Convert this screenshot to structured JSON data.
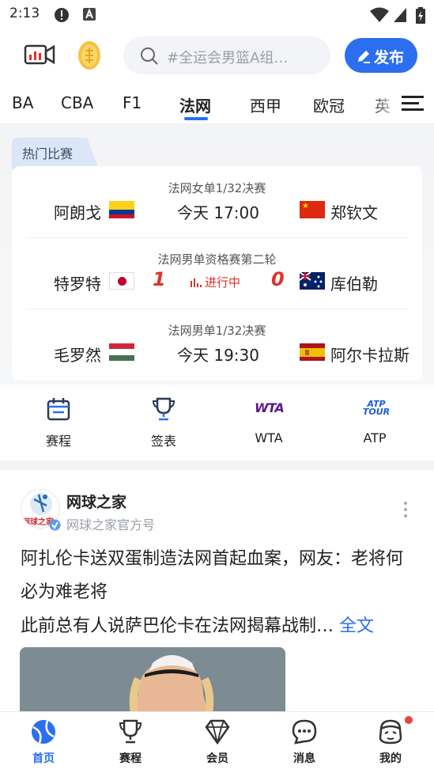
{
  "status_bar": {
    "time": "2:13",
    "icons": [
      "alert-circle-icon",
      "app-a-icon",
      "wifi-icon",
      "signal-icon",
      "battery-charging-icon"
    ]
  },
  "top_bar": {
    "left_icons": [
      "video-chart-icon",
      "gold-coin-icon"
    ],
    "search_placeholder": "#全运会男篮A组…",
    "publish_label": "发布"
  },
  "tabs": {
    "items": [
      "BA",
      "CBA",
      "F1",
      "法网",
      "西甲",
      "欧冠",
      "英"
    ],
    "active": "法网",
    "menu_icon": "menu-icon"
  },
  "hot_matches": {
    "tag": "热门比赛",
    "matches": [
      {
        "stage": "法网女单1/32决赛",
        "left_player": "阿朗戈",
        "left_flag": "Colombia",
        "center": "今天 17:00",
        "right_player": "郑钦文",
        "right_flag": "China"
      },
      {
        "stage": "法网男单资格赛第二轮",
        "left_player": "特罗特",
        "left_flag": "Japan",
        "left_score": "1",
        "status": "进行中",
        "right_score": "0",
        "right_player": "库伯勒",
        "right_flag": "Australia"
      },
      {
        "stage": "法网男单1/32决赛",
        "left_player": "毛罗然",
        "left_flag": "Hungary",
        "center": "今天 19:30",
        "right_player": "阿尔卡拉斯",
        "right_flag": "Spain"
      }
    ]
  },
  "quick_links": [
    {
      "label": "赛程",
      "icon": "calendar-icon"
    },
    {
      "label": "签表",
      "icon": "trophy-icon"
    },
    {
      "label": "WTA",
      "icon": "wta-logo-icon",
      "logo_text": "WTA"
    },
    {
      "label": "ATP",
      "icon": "atp-tour-logo-icon",
      "logo_text": "ATP TOUR"
    }
  ],
  "post": {
    "author": "网球之家",
    "author_subtitle": "网球之家官方号",
    "avatar_text": "网球之家",
    "title": "阿扎伦卡送双蛋制造法网首起血案，网友：老将何必为难老将",
    "excerpt": "此前总有人说萨巴伦卡在法网揭幕战制…",
    "full_text_label": "全文"
  },
  "bottom_nav": {
    "items": [
      {
        "label": "首页",
        "icon": "tennis-ball-icon",
        "active": true
      },
      {
        "label": "赛程",
        "icon": "trophy-icon",
        "active": false
      },
      {
        "label": "会员",
        "icon": "diamond-icon",
        "active": false
      },
      {
        "label": "消息",
        "icon": "chat-bubble-icon",
        "active": false
      },
      {
        "label": "我的",
        "icon": "profile-mascot-icon",
        "active": false,
        "has_badge": true
      }
    ]
  },
  "colors": {
    "accent": "#2b6ff0",
    "live": "#e0312b",
    "badge": "#f0413b"
  }
}
